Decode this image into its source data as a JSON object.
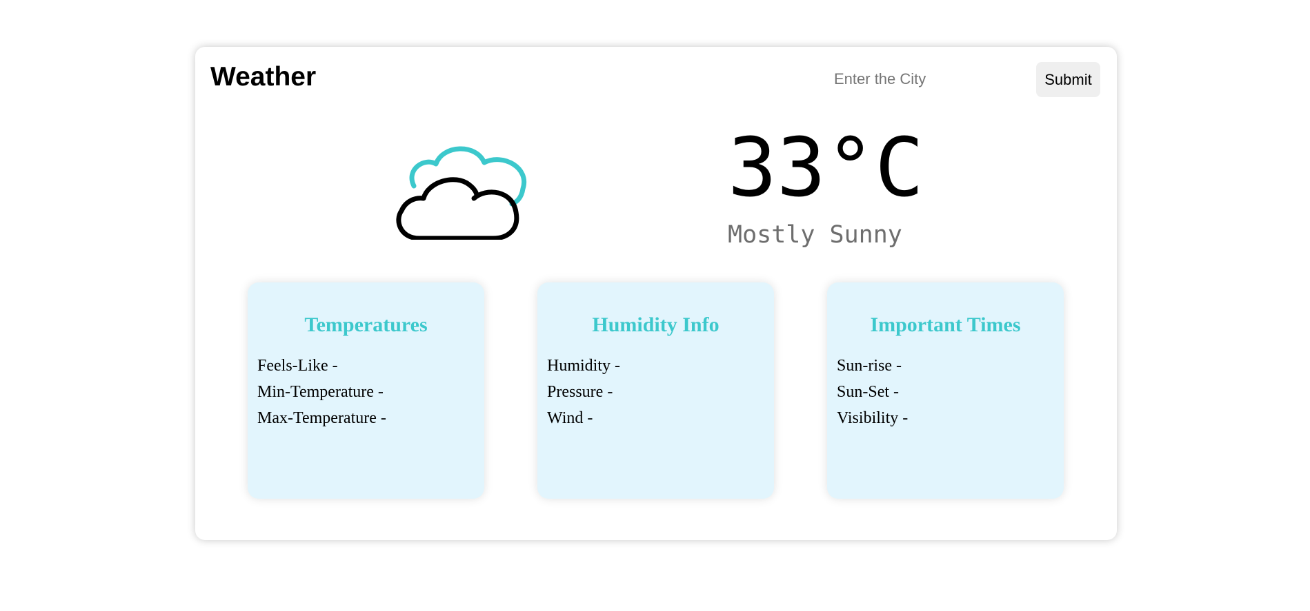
{
  "header": {
    "title": "Weather",
    "search_placeholder": "Enter the City",
    "submit_label": "Submit"
  },
  "current": {
    "temperature": "33°C",
    "condition": "Mostly Sunny",
    "icon": "cloudy-icon"
  },
  "colors": {
    "accent": "#3cc8cc",
    "panel_bg": "#e2f5fd"
  },
  "panels": [
    {
      "heading": "Temperatures",
      "items": [
        "Feels-Like -",
        "Min-Temperature -",
        "Max-Temperature -"
      ]
    },
    {
      "heading": "Humidity Info",
      "items": [
        "Humidity -",
        "Pressure -",
        "Wind -"
      ]
    },
    {
      "heading": "Important Times",
      "items": [
        "Sun-rise -",
        "Sun-Set -",
        "Visibility -"
      ]
    }
  ]
}
